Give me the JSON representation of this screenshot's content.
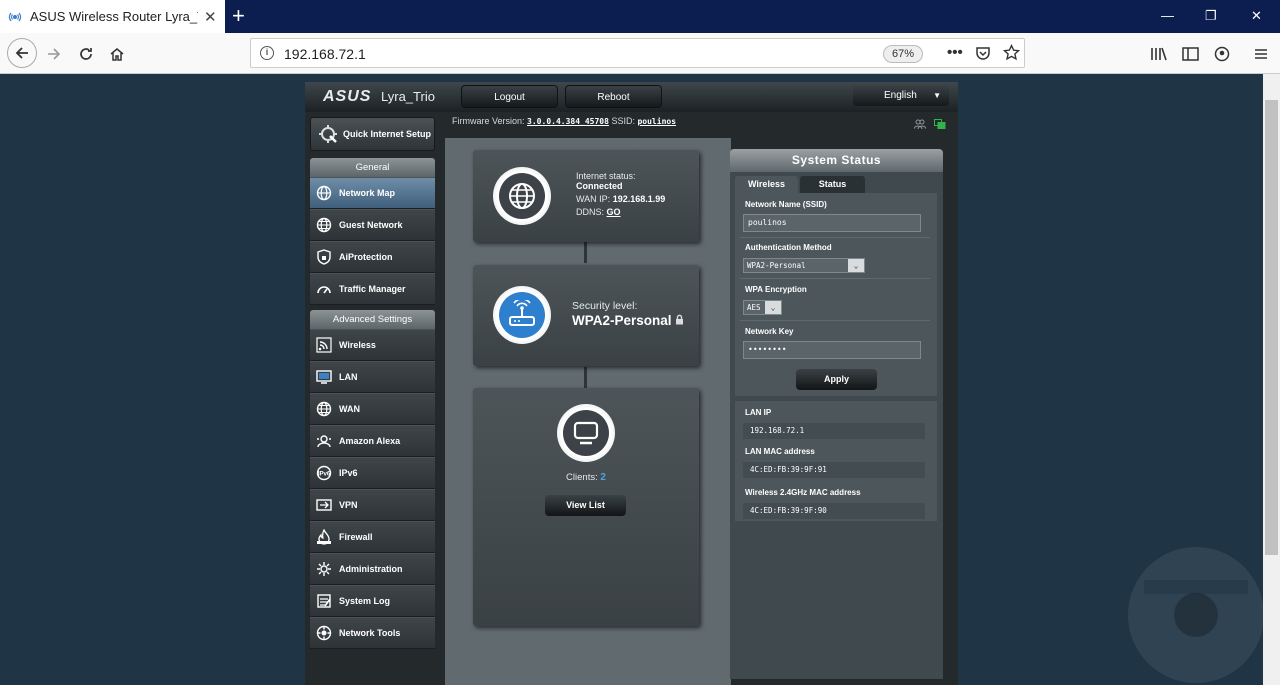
{
  "browser": {
    "tab_title": "ASUS Wireless Router Lyra_Trio",
    "new_tab": "+",
    "url": "192.168.72.1",
    "zoom": "67%",
    "minimize": "—",
    "restore": "❐",
    "close": "✕"
  },
  "router": {
    "brand": "ASUS",
    "model": "Lyra_Trio",
    "logout_label": "Logout",
    "reboot_label": "Reboot",
    "language": "English",
    "firmware_label": "Firmware Version:",
    "firmware_value": "3.0.0.4.384_45708",
    "ssid_label": "SSID:",
    "ssid_value": "poulinos"
  },
  "sidebar": {
    "quick_setup": "Quick Internet Setup",
    "general_header": "General",
    "general_items": [
      {
        "label": "Network Map",
        "icon": "network-map-icon",
        "active": true
      },
      {
        "label": "Guest Network",
        "icon": "globe-icon"
      },
      {
        "label": "AiProtection",
        "icon": "shield-icon"
      },
      {
        "label": "Traffic Manager",
        "icon": "gauge-icon"
      }
    ],
    "advanced_header": "Advanced Settings",
    "advanced_items": [
      {
        "label": "Wireless",
        "icon": "wifi-icon"
      },
      {
        "label": "LAN",
        "icon": "monitor-icon"
      },
      {
        "label": "WAN",
        "icon": "globe-icon"
      },
      {
        "label": "Amazon Alexa",
        "icon": "alexa-icon"
      },
      {
        "label": "IPv6",
        "icon": "ipv6-icon"
      },
      {
        "label": "VPN",
        "icon": "vpn-icon"
      },
      {
        "label": "Firewall",
        "icon": "fire-icon"
      },
      {
        "label": "Administration",
        "icon": "admin-icon"
      },
      {
        "label": "System Log",
        "icon": "log-icon"
      },
      {
        "label": "Network Tools",
        "icon": "tools-icon"
      }
    ]
  },
  "network_map": {
    "internet_status_label": "Internet status:",
    "internet_status_value": "Connected",
    "wan_ip_label": "WAN IP:",
    "wan_ip_value": "192.168.1.99",
    "ddns_label": "DDNS:",
    "ddns_value": "GO",
    "security_label": "Security level:",
    "security_value": "WPA2-Personal",
    "clients_label": "Clients:",
    "clients_value": "2",
    "view_list_label": "View List"
  },
  "system_status": {
    "title": "System Status",
    "tabs": [
      "Wireless",
      "Status"
    ],
    "network_name_label": "Network Name (SSID)",
    "network_name_value": "poulinos",
    "auth_method_label": "Authentication Method",
    "auth_method_value": "WPA2-Personal",
    "wpa_encryption_label": "WPA Encryption",
    "wpa_encryption_value": "AES",
    "network_key_label": "Network Key",
    "network_key_value": "••••••••",
    "apply_label": "Apply",
    "lan_ip_label": "LAN IP",
    "lan_ip_value": "192.168.72.1",
    "lan_mac_label": "LAN MAC address",
    "lan_mac_value": "4C:ED:FB:39:9F:91",
    "wifi_mac_label": "Wireless 2.4GHz MAC address",
    "wifi_mac_value": "4C:ED:FB:39:9F:90"
  },
  "colors": {
    "accent_blue": "#3f7fc4",
    "panel_dark": "#24292c",
    "link_highlight": "#4da3e0"
  }
}
